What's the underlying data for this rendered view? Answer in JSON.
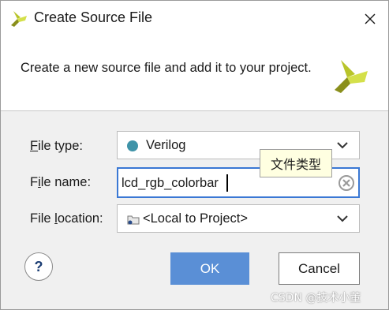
{
  "window": {
    "title": "Create Source File",
    "close_icon": "close-icon",
    "logo_icon": "vivado-logo-icon"
  },
  "header": {
    "description": "Create a new source file and add it to your project."
  },
  "form": {
    "file_type": {
      "label_mnemonic": "F",
      "label_rest": "ile type:",
      "value": "Verilog",
      "icon": "verilog-dot-icon",
      "icon_color": "#3f93a8"
    },
    "file_name": {
      "label_pre": "F",
      "label_mnemonic": "i",
      "label_rest": "le name:",
      "value": "lcd_rgb_colorbar",
      "clear_icon": "clear-icon"
    },
    "file_location": {
      "label_pre": "File ",
      "label_mnemonic": "l",
      "label_rest": "ocation:",
      "value": "<Local to Project>",
      "icon": "folder-icon"
    }
  },
  "tooltip": {
    "text": "文件类型"
  },
  "buttons": {
    "help": "?",
    "ok": "OK",
    "cancel": "Cancel"
  },
  "watermark": "CSDN @技术小董",
  "colors": {
    "accent": "#3a78d4",
    "ok_button": "#5a8fd6",
    "logo_yellow": "#c9d63a",
    "logo_olive": "#8a8f1c"
  }
}
